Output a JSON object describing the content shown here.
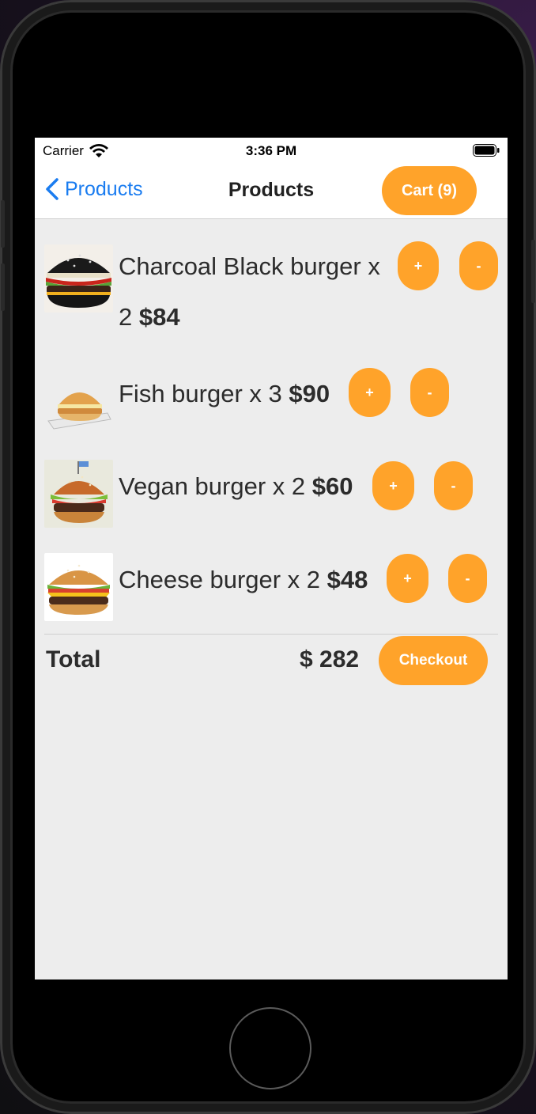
{
  "status_bar": {
    "carrier": "Carrier",
    "time": "3:36 PM",
    "icons": [
      "wifi-icon",
      "battery-icon"
    ]
  },
  "navbar": {
    "back_label": "Products",
    "title": "Products",
    "cart_label": "Cart (9)"
  },
  "items": [
    {
      "name_line": "Charcoal Black burger x",
      "qty": "2",
      "price": "$84",
      "plus": "+",
      "minus": "-",
      "image": "charcoal-black-burger-image"
    },
    {
      "name": "Fish burger x 3",
      "price": "$90",
      "plus": "+",
      "minus": "-",
      "image": "fish-burger-image"
    },
    {
      "name": "Vegan burger x 2",
      "price": "$60",
      "plus": "+",
      "minus": "-",
      "image": "vegan-burger-image"
    },
    {
      "name": "Cheese burger x 2",
      "price": "$48",
      "plus": "+",
      "minus": "-",
      "image": "cheese-burger-image"
    }
  ],
  "summary": {
    "total_label": "Total",
    "total_value": "$ 282",
    "checkout_label": "Checkout"
  },
  "colors": {
    "accent": "#ffa32a",
    "link": "#1a7cf0",
    "background": "#ededed"
  }
}
